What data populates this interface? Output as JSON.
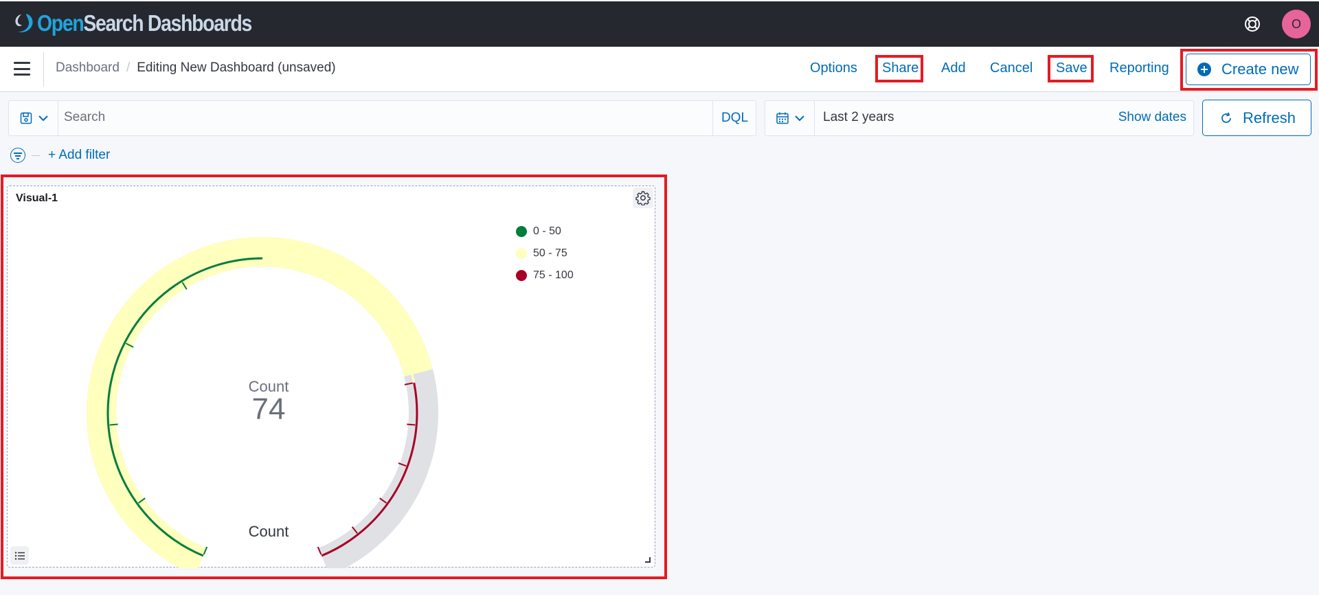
{
  "app": {
    "logo_open": "Open",
    "logo_rest": "Search Dashboards",
    "avatar_initial": "O"
  },
  "breadcrumb": [
    "Dashboard",
    "Editing New Dashboard (unsaved)"
  ],
  "top_actions": {
    "options": "Options",
    "share": "Share",
    "add": "Add",
    "cancel": "Cancel",
    "save": "Save",
    "reporting": "Reporting",
    "create_new": "Create new"
  },
  "query_bar": {
    "search_placeholder": "Search",
    "language": "DQL",
    "time_range": "Last 2 years",
    "show_dates": "Show dates",
    "refresh": "Refresh"
  },
  "filters": {
    "add_filter": "+ Add filter"
  },
  "panel": {
    "title": "Visual-1",
    "metric_label": "Count",
    "metric_value": "74",
    "footer_label": "Count",
    "legend": [
      {
        "label": "0 - 50",
        "color": "#007d3c"
      },
      {
        "label": "50 - 75",
        "color": "#ffffbe"
      },
      {
        "label": "75 - 100",
        "color": "#a50026"
      }
    ]
  },
  "chart_data": {
    "type": "gauge",
    "value": 74,
    "min": 0,
    "max": 100,
    "ranges": [
      {
        "from": 0,
        "to": 50,
        "color": "#007d3c"
      },
      {
        "from": 50,
        "to": 75,
        "color": "#ffffbe"
      },
      {
        "from": 75,
        "to": 100,
        "color": "#a50026"
      }
    ],
    "label": "Count",
    "footer": "Count"
  },
  "colors": {
    "header_bg": "#25282f",
    "link": "#006bb8",
    "highlight": "#e31b23",
    "avatar": "#e7649a",
    "gauge_track": "#e0e1e5"
  }
}
